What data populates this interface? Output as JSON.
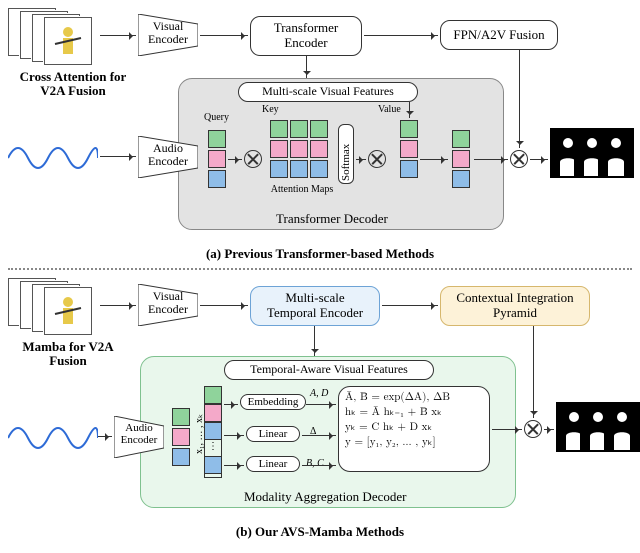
{
  "panelA": {
    "title": "(a) Previous Transformer-based Methods",
    "fusionLabel": "Cross Attention for\nV2A Fusion",
    "visualEncoder": "Visual\nEncoder",
    "audioEncoder": "Audio\nEncoder",
    "transformerEncoder": "Transformer\nEncoder",
    "fpn": "FPN/A2V Fusion",
    "multiScale": "Multi-scale Visual Features",
    "key": "Key",
    "value": "Value",
    "query": "Query",
    "attentionMaps": "Attention Maps",
    "softmax": "Softmax",
    "decoderLabel": "Transformer Decoder"
  },
  "panelB": {
    "title": "(b) Our AVS-Mamba Methods",
    "fusionLabel": "Mamba for V2A\nFusion",
    "visualEncoder": "Visual\nEncoder",
    "audioEncoder": "Audio\nEncoder",
    "temporalEncoder": "Multi-scale\nTemporal Encoder",
    "cip": "Contextual Integration\nPyramid",
    "tvFeatures": "Temporal-Aware Visual Features",
    "embedding": "Embedding",
    "linear": "Linear",
    "seqLabel": "x₁, … , xₖ",
    "eqAD": "A, D",
    "eqDelta": "Δ",
    "eqBC": "B, C",
    "eq1": "Ā, B̄ = exp(ΔA), ΔB",
    "eq2": "hₖ = Ā hₖ₋₁ + B̄ xₖ",
    "eq3": "yₖ = C hₖ + D xₖ",
    "eq4": "y = [y₁, y₂, … , yₖ]",
    "decoderLabel": "Modality Aggregation Decoder"
  },
  "chart_data": {
    "type": "diagram",
    "description": "Comparison of two audio-visual segmentation pipelines.",
    "panels": [
      {
        "id": "a",
        "title": "Previous Transformer-based Methods",
        "flow": [
          "video frames → Visual Encoder → Transformer Encoder → FPN/A2V Fusion",
          "Transformer Encoder → Multi-scale Visual Features (Key, Value)",
          "audio waveform → Audio Encoder → Query tokens",
          "Cross-attention (Query ⊗ Key → Attention Maps → Softmax → ⊗ Value) → fused tokens",
          "fused tokens ⊗ FPN/A2V Fusion → segmentation masks"
        ],
        "fusion_mechanism": "Cross Attention for V2A Fusion",
        "decoder": "Transformer Decoder"
      },
      {
        "id": "b",
        "title": "Our AVS-Mamba Methods",
        "flow": [
          "video frames → Visual Encoder → Multi-scale Temporal Encoder → Contextual Integration Pyramid",
          "Multi-scale Temporal Encoder → Temporal-Aware Visual Features",
          "audio waveform → Audio Encoder → audio tokens",
          "audio tokens + visual feature sequence [x₁,…,xₖ] → Mamba SSM block (Embedding→A,D ; Linear→Δ ; Linear→B,C)",
          "SSM recurrence: Ā,B̄ = exp(ΔA),ΔB ; hₖ = Āhₖ₋₁ + B̄xₖ ; yₖ = Chₖ + Dxₖ ; y=[y₁,…,yₖ]",
          "y ⊗ Contextual Integration Pyramid → segmentation masks"
        ],
        "fusion_mechanism": "Mamba for V2A Fusion",
        "decoder": "Modality Aggregation Decoder"
      }
    ]
  }
}
